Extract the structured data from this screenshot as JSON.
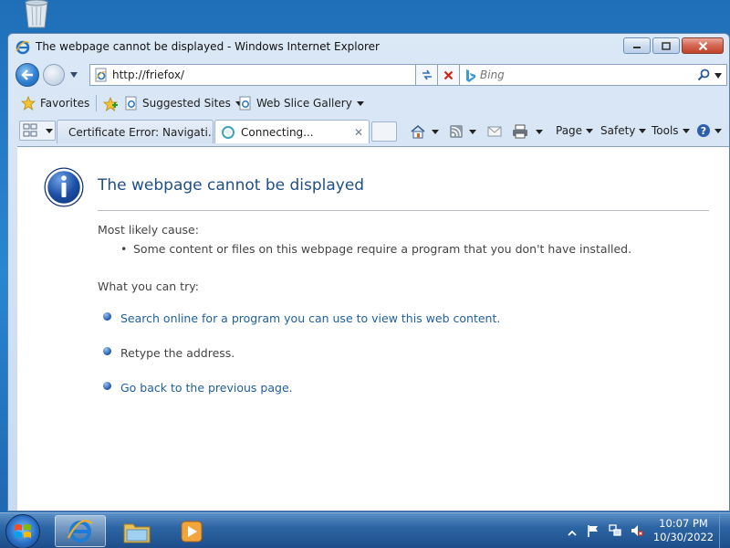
{
  "window": {
    "title": "The webpage cannot be displayed - Windows Internet Explorer"
  },
  "address_bar": {
    "url": "http://friefox/"
  },
  "search": {
    "placeholder": "Bing"
  },
  "favorites_bar": {
    "favorites_label": "Favorites",
    "suggested_sites_label": "Suggested Sites",
    "web_slice_gallery_label": "Web Slice Gallery"
  },
  "tabs": [
    {
      "label": "Certificate Error: Navigati..."
    },
    {
      "label": "Connecting..."
    }
  ],
  "command_bar": {
    "page_label": "Page",
    "safety_label": "Safety",
    "tools_label": "Tools"
  },
  "content": {
    "heading": "The webpage cannot be displayed",
    "cause_label": "Most likely cause:",
    "cause_item": "Some content or files on this webpage require a program that you don't have installed.",
    "try_label": "What you can try:",
    "try_items": [
      {
        "text": "Search online for a program you can use to view this web content."
      },
      {
        "text": "Retype the address."
      },
      {
        "text": "Go back to the previous page."
      }
    ]
  },
  "taskbar": {
    "time": "10:07 PM",
    "date": "10/30/2022"
  },
  "colors": {
    "link": "#1f5f9e",
    "heading": "#1f4f86",
    "taskbar": "#2d65a4"
  }
}
